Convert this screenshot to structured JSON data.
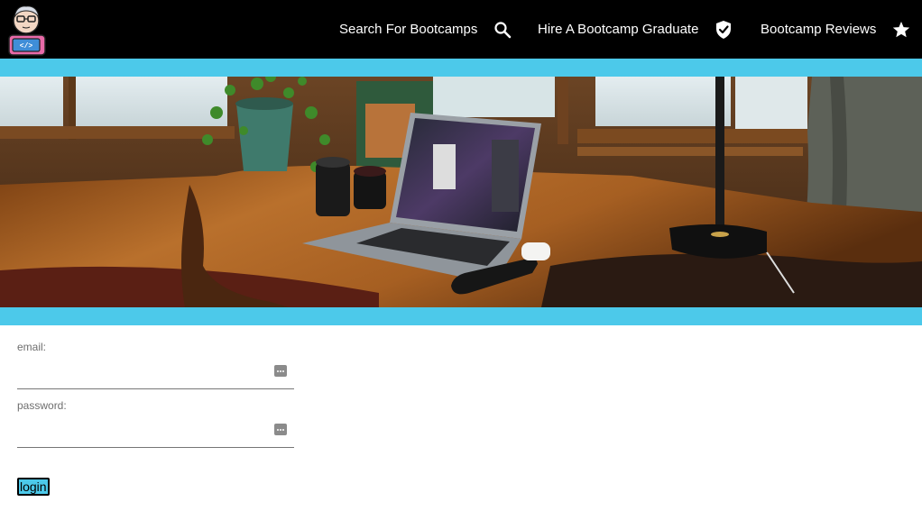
{
  "header": {
    "logo_icon": "developer-avatar-logo",
    "nav": [
      {
        "label": "Search For Bootcamps",
        "icon": "search-icon"
      },
      {
        "label": "Hire A Bootcamp Graduate",
        "icon": "shield-check-icon"
      },
      {
        "label": "Bootcamp Reviews",
        "icon": "star-icon"
      }
    ]
  },
  "colors": {
    "accent": "#4cc9ea",
    "header_bg": "#000000"
  },
  "login_form": {
    "email_label": "email:",
    "email_value": "",
    "password_label": "password:",
    "password_value": "",
    "submit_label": "login"
  }
}
